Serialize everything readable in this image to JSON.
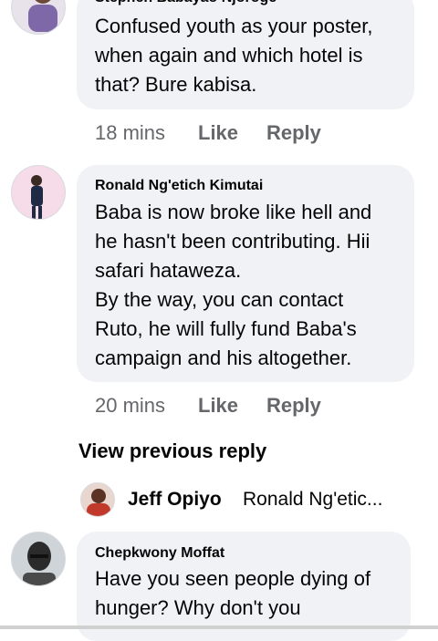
{
  "comments": [
    {
      "author": "Stephen Babayao Njoroge",
      "text": "Confused youth as your poster,\nwhen again and which hotel is\nthat? Bure kabisa.",
      "time": "18 mins",
      "like_label": "Like",
      "reply_label": "Reply"
    },
    {
      "author": "Ronald Ng'etich Kimutai",
      "text": "Baba is now broke like hell and\nhe hasn't been contributing. Hii\nsafari hataweza.\nBy the way, you can contact\nRuto, he will fully fund Baba's\ncampaign and his altogether.",
      "time": "20 mins",
      "like_label": "Like",
      "reply_label": "Reply"
    },
    {
      "author": "Chepkwony Moffat",
      "text": "Have you seen people dying of\nhunger? Why don't you"
    }
  ],
  "view_previous_reply": "View previous reply",
  "reply_preview": {
    "name": "Jeff Opiyo",
    "snippet": "Ronald Ng'etic..."
  }
}
